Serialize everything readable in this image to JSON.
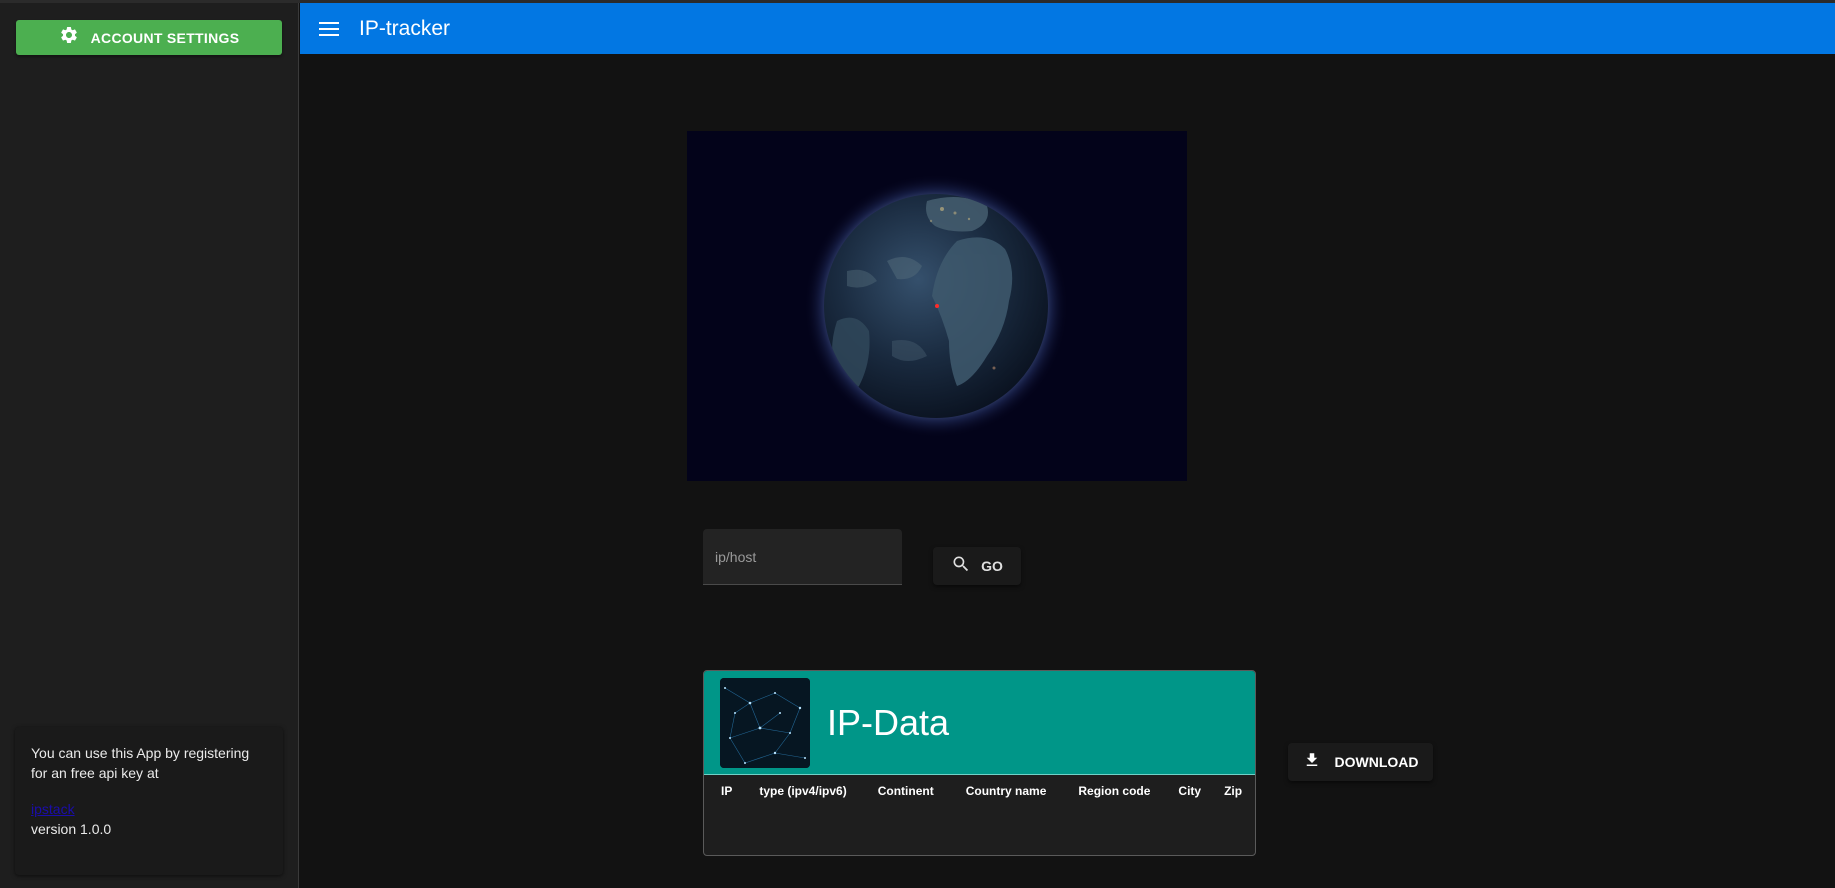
{
  "app": {
    "title": "IP-tracker"
  },
  "sidebar": {
    "account_settings_label": "ACCOUNT SETTINGS",
    "info": {
      "text": "You can use this App by registering for an free api key at",
      "link_text": "ipstack",
      "version": "version 1.0.0"
    }
  },
  "search": {
    "placeholder": "ip/host",
    "value": "",
    "go_label": "GO"
  },
  "ip_data": {
    "title": "IP-Data",
    "columns": [
      "IP",
      "type (ipv4/ipv6)",
      "Continent",
      "Country name",
      "Region code",
      "City",
      "Zip"
    ],
    "rows": []
  },
  "download_label": "DOWNLOAD",
  "colors": {
    "appbar": "#0277e3",
    "account_button": "#4caf50",
    "card_header": "#009688",
    "globe_background": "#03031a",
    "marker": "#ff2a2a"
  },
  "icons": {
    "menu": "hamburger-menu-icon",
    "settings": "gear-icon",
    "search": "search-icon",
    "download": "download-icon"
  }
}
